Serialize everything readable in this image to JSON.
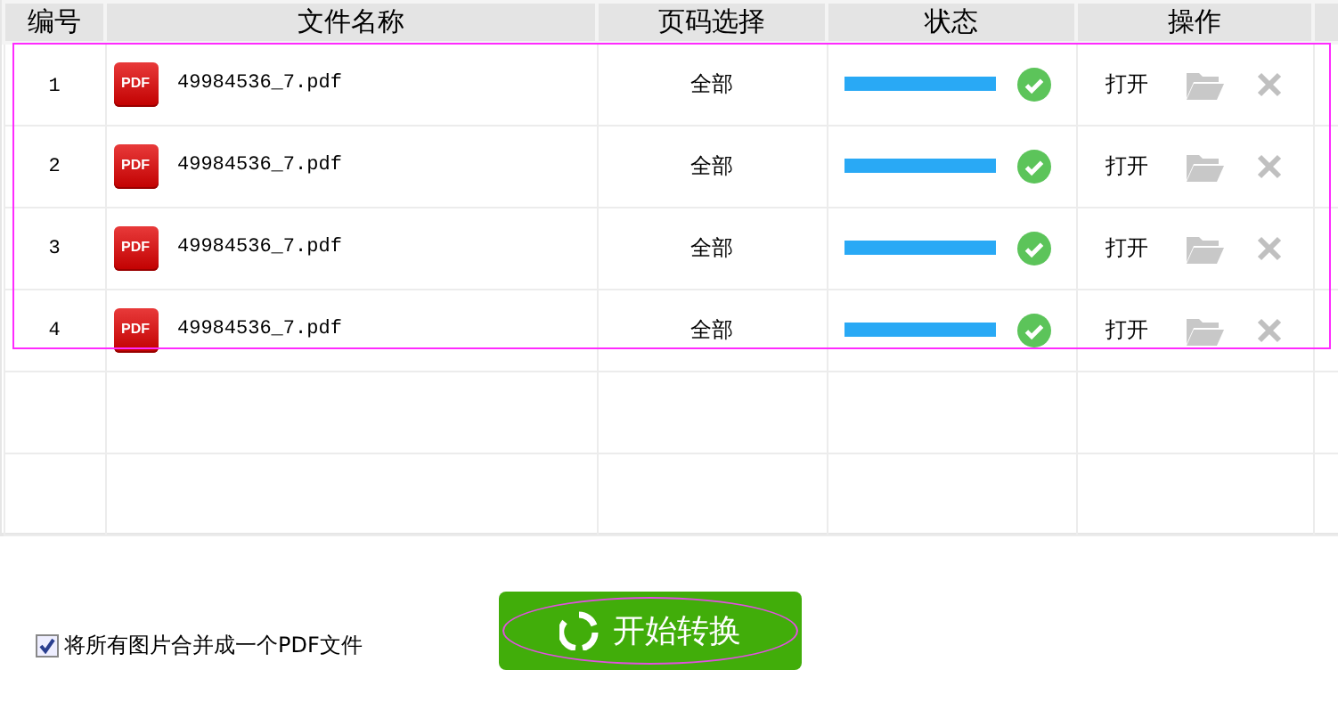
{
  "table": {
    "columns": [
      "编号",
      "文件名称",
      "页码选择",
      "状态",
      "操作"
    ],
    "rows": [
      {
        "number": "1",
        "icon_label": "PDF",
        "file_name": "49984536_7.pdf",
        "pages": "全部",
        "level": 1,
        "done": true,
        "open_label": "打开",
        "selected": true
      },
      {
        "number": "2",
        "icon_label": "PDF",
        "file_name": "49984536_7.pdf",
        "pages": "全部",
        "level": 1,
        "done": true,
        "open_label": "打开",
        "selected": true
      },
      {
        "number": "3",
        "icon_label": "PDF",
        "file_name": "49984536_7.pdf",
        "pages": "全部",
        "level": 1,
        "done": true,
        "open_label": "打开",
        "selected": true
      },
      {
        "number": "4",
        "icon_label": "PDF",
        "file_name": "49984536_7.pdf",
        "pages": "全部",
        "level": 1,
        "done": true,
        "open_label": "打开",
        "selected": true
      }
    ]
  },
  "merge_option": {
    "label": "将所有图片合并成一个PDF文件",
    "checked": true
  },
  "start_button": {
    "label": "开始转换",
    "focused": true
  }
}
